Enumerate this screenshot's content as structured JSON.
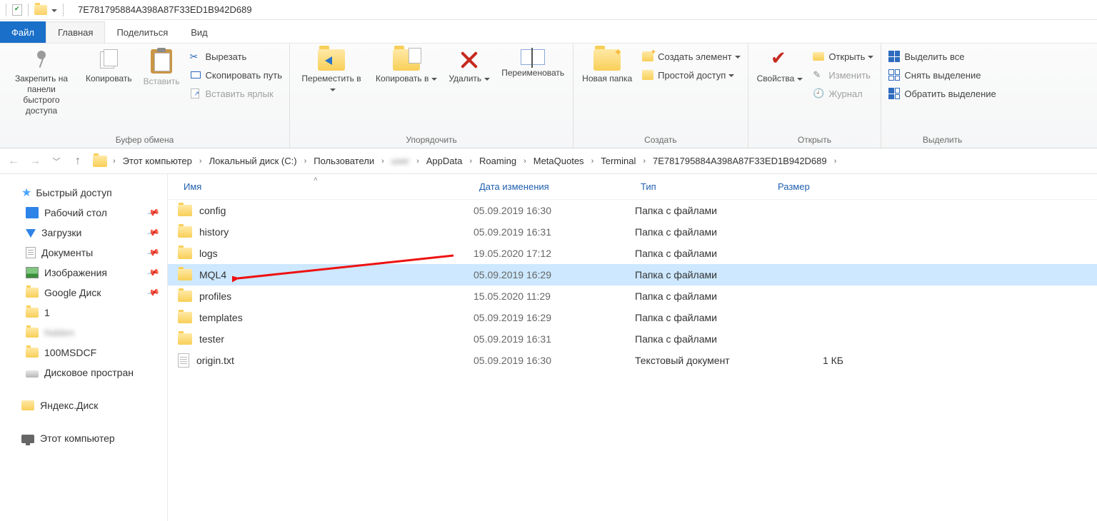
{
  "window": {
    "title": "7E781795884A398A87F33ED1B942D689"
  },
  "tabs": {
    "file": "Файл",
    "home": "Главная",
    "share": "Поделиться",
    "view": "Вид"
  },
  "ribbon": {
    "clipboard": {
      "pin": "Закрепить на панели быстрого доступа",
      "copy": "Копировать",
      "paste": "Вставить",
      "cut": "Вырезать",
      "copy_path": "Скопировать путь",
      "paste_shortcut": "Вставить ярлык",
      "group": "Буфер обмена"
    },
    "organize": {
      "move": "Переместить в",
      "copy_to": "Копировать в",
      "delete": "Удалить",
      "rename": "Переименовать",
      "group": "Упорядочить"
    },
    "new": {
      "new_folder": "Новая папка",
      "new_item": "Создать элемент",
      "easy_access": "Простой доступ",
      "group": "Создать"
    },
    "open": {
      "properties": "Свойства",
      "open": "Открыть",
      "edit": "Изменить",
      "history": "Журнал",
      "group": "Открыть"
    },
    "select": {
      "select_all": "Выделить все",
      "select_none": "Снять выделение",
      "invert": "Обратить выделение",
      "group": "Выделить"
    }
  },
  "breadcrumb": {
    "segments": [
      "Этот компьютер",
      "Локальный диск (C:)",
      "Пользователи",
      "",
      "AppData",
      "Roaming",
      "MetaQuotes",
      "Terminal",
      "7E781795884A398A87F33ED1B942D689"
    ]
  },
  "sidebar": {
    "quick": "Быстрый доступ",
    "desktop": "Рабочий стол",
    "downloads": "Загрузки",
    "documents": "Документы",
    "pictures": "Изображения",
    "gdrive": "Google Диск",
    "one": "1",
    "blurred": "      ",
    "msdcf": "100MSDCF",
    "disk_space": "Дисковое простран",
    "yadisk": "Яндекс.Диск",
    "this_pc": "Этот компьютер"
  },
  "columns": {
    "name": "Имя",
    "date": "Дата изменения",
    "type": "Тип",
    "size": "Размер"
  },
  "files": [
    {
      "name": "config",
      "date": "05.09.2019 16:30",
      "type": "Папка с файлами",
      "size": "",
      "kind": "folder",
      "selected": false
    },
    {
      "name": "history",
      "date": "05.09.2019 16:31",
      "type": "Папка с файлами",
      "size": "",
      "kind": "folder",
      "selected": false
    },
    {
      "name": "logs",
      "date": "19.05.2020 17:12",
      "type": "Папка с файлами",
      "size": "",
      "kind": "folder",
      "selected": false
    },
    {
      "name": "MQL4",
      "date": "05.09.2019 16:29",
      "type": "Папка с файлами",
      "size": "",
      "kind": "folder",
      "selected": true
    },
    {
      "name": "profiles",
      "date": "15.05.2020 11:29",
      "type": "Папка с файлами",
      "size": "",
      "kind": "folder",
      "selected": false
    },
    {
      "name": "templates",
      "date": "05.09.2019 16:29",
      "type": "Папка с файлами",
      "size": "",
      "kind": "folder",
      "selected": false
    },
    {
      "name": "tester",
      "date": "05.09.2019 16:31",
      "type": "Папка с файлами",
      "size": "",
      "kind": "folder",
      "selected": false
    },
    {
      "name": "origin.txt",
      "date": "05.09.2019 16:30",
      "type": "Текстовый документ",
      "size": "1 КБ",
      "kind": "txt",
      "selected": false
    }
  ]
}
